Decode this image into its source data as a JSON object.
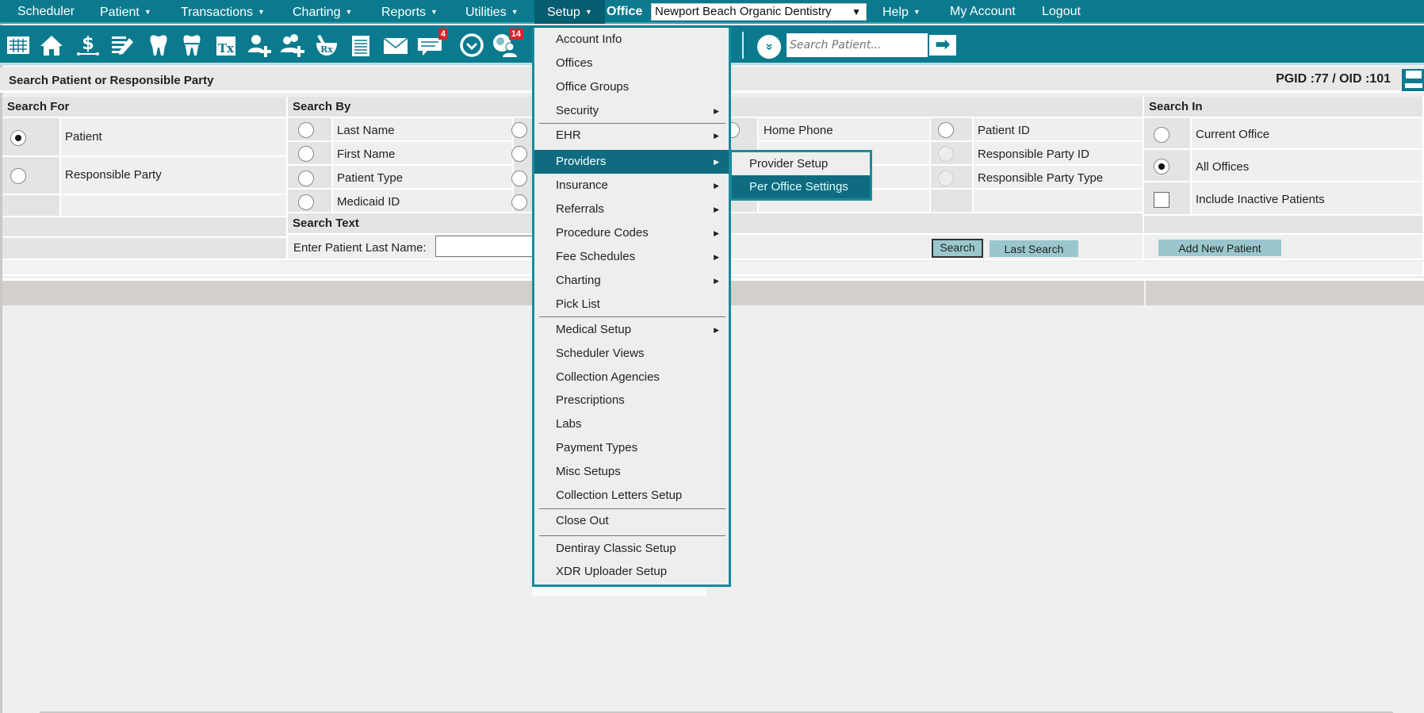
{
  "topnav": {
    "items": [
      {
        "label": "Scheduler",
        "caret": false
      },
      {
        "label": "Patient",
        "caret": true
      },
      {
        "label": "Transactions",
        "caret": true
      },
      {
        "label": "Charting",
        "caret": true
      },
      {
        "label": "Reports",
        "caret": true
      },
      {
        "label": "Utilities",
        "caret": true
      },
      {
        "label": "Setup",
        "caret": true,
        "active": true
      },
      {
        "label": "Help",
        "caret": true
      },
      {
        "label": "My Account",
        "caret": false
      },
      {
        "label": "Logout",
        "caret": false
      }
    ],
    "office_label": "Office",
    "office_value": "Newport Beach Organic Dentistry",
    "caret_glyph": "▼"
  },
  "toolbar": {
    "icons": [
      "calendar-icon",
      "home-icon",
      "billing-icon",
      "notes-icon",
      "tooth-icon",
      "crown-tooth-icon",
      "treatment-icon",
      "add-patient-icon",
      "add-family-icon",
      "prescription-icon",
      "notepad-icon",
      "mail-icon",
      "chat-icon",
      "clock-icon",
      "online-user-icon"
    ],
    "chat_badge": "4",
    "online_badge": "14",
    "search_placeholder": "Search Patient...",
    "expand_glyph": "»",
    "go_glyph": "➡"
  },
  "header": {
    "title": "Search Patient or Responsible Party",
    "pgid": "PGID :77  /  OID :101"
  },
  "search_for": {
    "title": "Search For",
    "options": [
      {
        "label": "Patient",
        "checked": true
      },
      {
        "label": "Responsible Party",
        "checked": false
      }
    ]
  },
  "search_by": {
    "title": "Search By",
    "col1": [
      "Last Name",
      "First Name",
      "Patient Type",
      "Medicaid ID"
    ],
    "col2_visible": [
      "Home Phone"
    ],
    "col3": [
      "Patient ID",
      "Responsible Party ID",
      "Responsible Party Type"
    ]
  },
  "search_text": {
    "title": "Search Text",
    "label": "Enter Patient Last Name:",
    "value": ""
  },
  "search_in": {
    "title": "Search In",
    "options": [
      {
        "label": "Current Office",
        "checked": false
      },
      {
        "label": "All Offices",
        "checked": true
      }
    ],
    "inactive_label": "Include Inactive Patients",
    "inactive_checked": false
  },
  "buttons": {
    "search": "Search",
    "last_search": "Last Search",
    "add_new_patient": "Add New Patient"
  },
  "setup_menu": {
    "items": [
      {
        "label": "Account Info",
        "submenu": false
      },
      {
        "label": "Offices",
        "submenu": false
      },
      {
        "label": "Office Groups",
        "submenu": false
      },
      {
        "label": "Security",
        "submenu": true
      },
      {
        "label": "EHR",
        "submenu": true
      },
      {
        "label": "Providers",
        "submenu": true,
        "active": true
      },
      {
        "label": "Insurance",
        "submenu": true
      },
      {
        "label": "Referrals",
        "submenu": true
      },
      {
        "label": "Procedure Codes",
        "submenu": true
      },
      {
        "label": "Fee Schedules",
        "submenu": true
      },
      {
        "label": "Charting",
        "submenu": true
      },
      {
        "label": "Pick List",
        "submenu": false
      },
      {
        "label": "Medical Setup",
        "submenu": true
      },
      {
        "label": "Scheduler Views",
        "submenu": false
      },
      {
        "label": "Collection Agencies",
        "submenu": false
      },
      {
        "label": "Prescriptions",
        "submenu": false
      },
      {
        "label": "Labs",
        "submenu": false
      },
      {
        "label": "Payment Types",
        "submenu": false
      },
      {
        "label": "Misc Setups",
        "submenu": false
      },
      {
        "label": "Collection Letters Setup",
        "submenu": false
      },
      {
        "label": "Close Out",
        "submenu": false
      },
      {
        "label": "Dentiray Classic Setup",
        "submenu": false
      },
      {
        "label": "XDR Uploader Setup",
        "submenu": false
      }
    ],
    "arrow_glyph": "▶"
  },
  "providers_submenu": {
    "items": [
      {
        "label": "Provider Setup",
        "active": false
      },
      {
        "label": "Per Office Settings",
        "active": true
      }
    ]
  }
}
